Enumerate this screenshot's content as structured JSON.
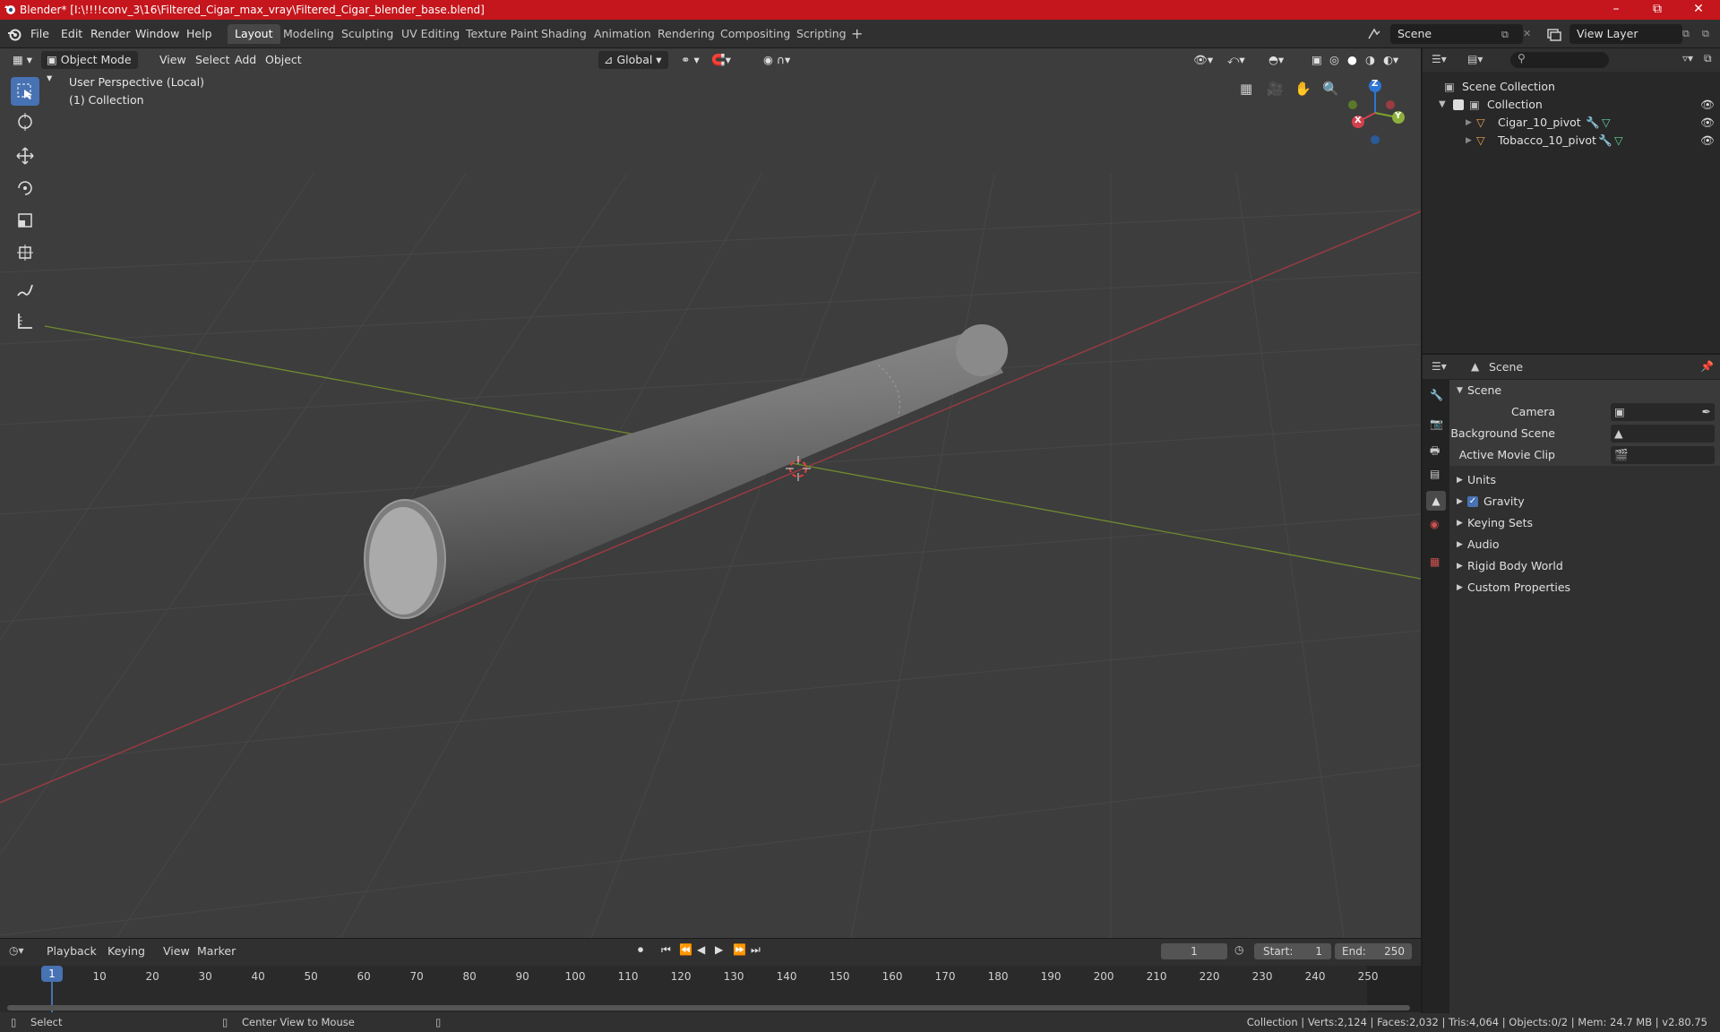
{
  "window": {
    "title": "Blender* [I:\\!!!!conv_3\\16\\Filtered_Cigar_max_vray\\Filtered_Cigar_blender_base.blend]",
    "accent_color": "#c4161c"
  },
  "menu": {
    "items": [
      "File",
      "Edit",
      "Render",
      "Window",
      "Help"
    ]
  },
  "workspaces": {
    "tabs": [
      "Layout",
      "Modeling",
      "Sculpting",
      "UV Editing",
      "Texture Paint",
      "Shading",
      "Animation",
      "Rendering",
      "Compositing",
      "Scripting"
    ],
    "active": "Layout",
    "add_icon": "plus-icon"
  },
  "top_right": {
    "scene": "Scene",
    "view_layer": "View Layer"
  },
  "viewport": {
    "mode": "Object Mode",
    "menus": [
      "View",
      "Select",
      "Add",
      "Object"
    ],
    "transform_orientation": "Global",
    "overlay_line1": "User Perspective (Local)",
    "overlay_line2": "(1) Collection",
    "gizmo": {
      "x": "X",
      "y": "Y",
      "z": "Z"
    },
    "selected_tool_color": "#4772b3"
  },
  "outliner": {
    "root": "Scene Collection",
    "collection": "Collection",
    "objects": [
      "Cigar_10_pivot",
      "Tobacco_10_pivot"
    ]
  },
  "properties": {
    "header": "Scene",
    "panel_title": "Scene",
    "fields": {
      "camera_label": "Camera",
      "background_label": "Background Scene",
      "movie_clip_label": "Active Movie Clip"
    },
    "sections": [
      "Units",
      "Gravity",
      "Keying Sets",
      "Audio",
      "Rigid Body World",
      "Custom Properties"
    ],
    "gravity_checked": true
  },
  "timeline": {
    "menus": [
      "Playback",
      "Keying",
      "View",
      "Marker"
    ],
    "current_frame": "1",
    "start_label": "Start:",
    "start": "1",
    "end_label": "End:",
    "end": "250",
    "ticks": [
      "10",
      "20",
      "30",
      "40",
      "50",
      "60",
      "70",
      "80",
      "90",
      "100",
      "110",
      "120",
      "130",
      "140",
      "150",
      "160",
      "170",
      "180",
      "190",
      "200",
      "210",
      "220",
      "230",
      "240",
      "250"
    ],
    "current_tick": "1"
  },
  "statusbar": {
    "left": "Select",
    "middle": "Center View to Mouse",
    "right": "Collection | Verts:2,124 | Faces:2,032 | Tris:4,064 | Objects:0/2 | Mem: 24.7 MB | v2.80.75"
  }
}
